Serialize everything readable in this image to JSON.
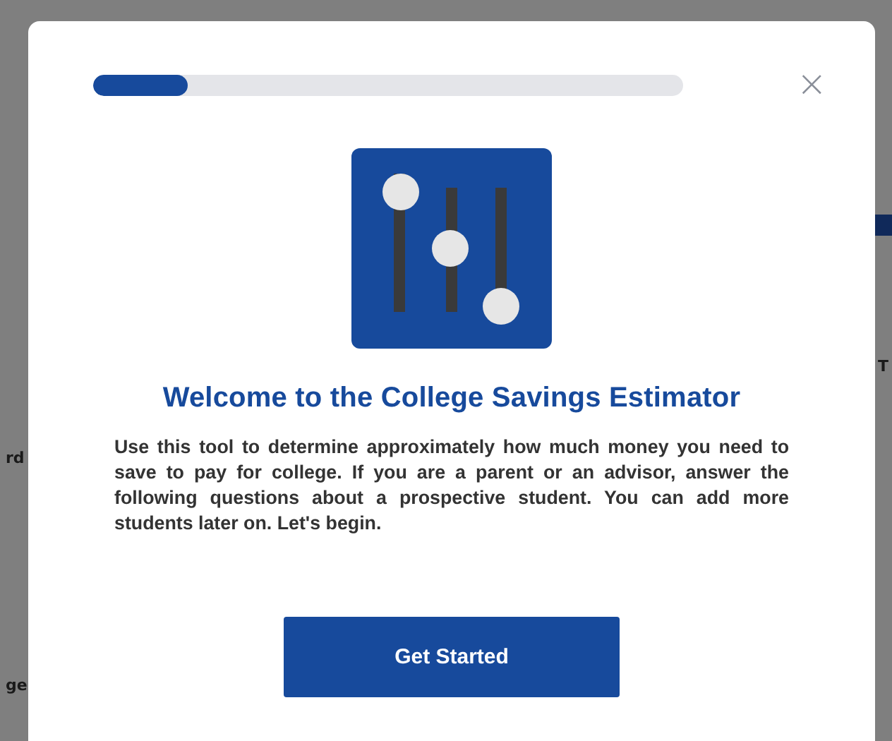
{
  "background_page": {
    "left_fragments": [
      "rd",
      "ge"
    ],
    "right_fragments": [
      "T"
    ]
  },
  "modal": {
    "progress": {
      "level": 0.16
    },
    "close_label": "×",
    "title": "Welcome to the College Savings Estimator",
    "description": "Use this tool to determine approximately how much money you need to save to pay for college. If you are a parent or an advisor, answer the following questions about a prospective student. You can add more students later on. Let's begin.",
    "primary_button": "Get Started"
  }
}
